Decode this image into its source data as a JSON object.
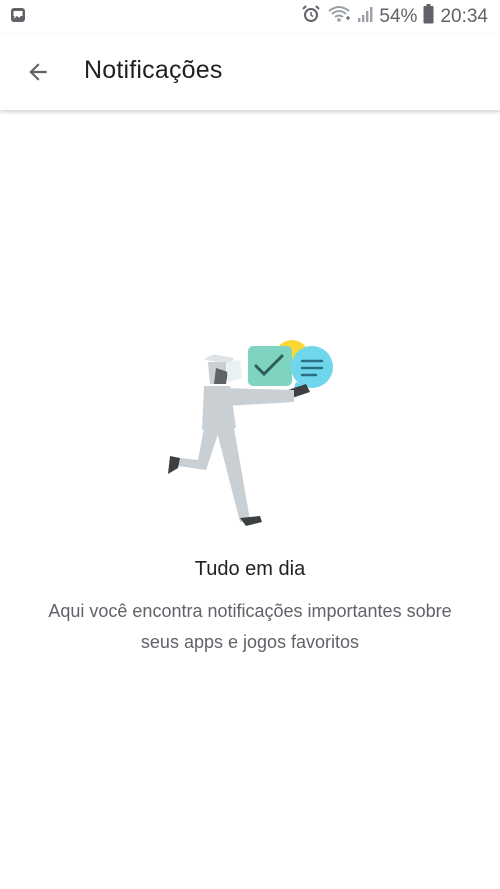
{
  "status_bar": {
    "battery_percent": "54%",
    "time": "20:34",
    "icons": [
      "image-icon",
      "alarm-icon",
      "wifi-icon",
      "signal-icon",
      "battery-icon"
    ]
  },
  "app_bar": {
    "title": "Notificações",
    "back_icon": "arrow-back-icon"
  },
  "empty_state": {
    "illustration": "person-carrying-notifications-illustration",
    "title": "Tudo em dia",
    "description": "Aqui você encontra notificações importantes sobre seus apps e jogos favoritos"
  },
  "colors": {
    "title_text": "#202124",
    "secondary_text": "#5f6368",
    "illustration_green": "#7fd3c1",
    "illustration_cyan": "#6fd6ec",
    "illustration_yellow": "#fdd835",
    "illustration_figure": "#c9cfd3"
  }
}
